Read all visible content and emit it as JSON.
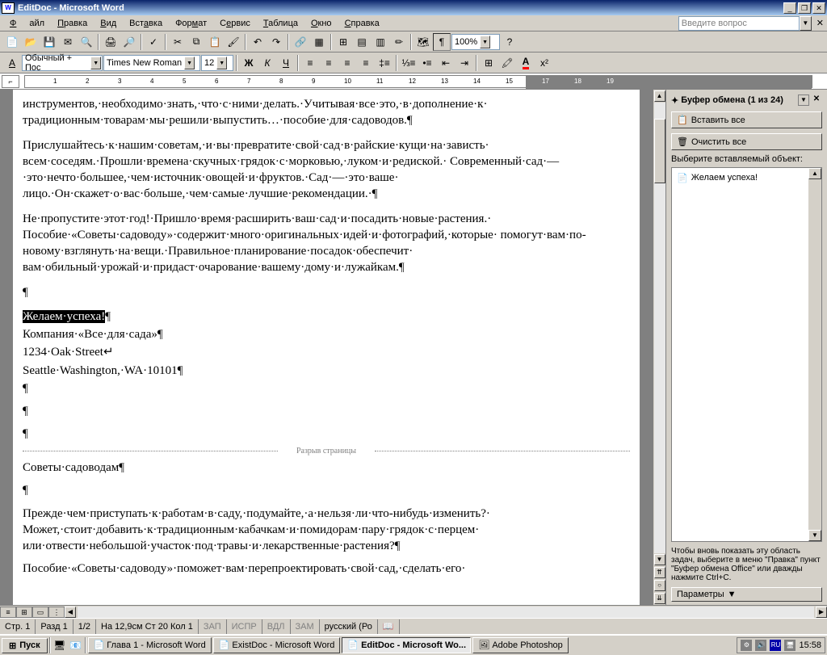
{
  "window": {
    "title": "EditDoc - Microsoft Word"
  },
  "menu": {
    "file": "Файл",
    "edit": "Правка",
    "view": "Вид",
    "insert": "Вставка",
    "format": "Формат",
    "tools": "Сервис",
    "table": "Таблица",
    "window": "Окно",
    "help": "Справка"
  },
  "askbox": {
    "placeholder": "Введите вопрос"
  },
  "toolbar2": {
    "style": "Обычный + Пос",
    "font": "Times New Roman",
    "size": "12"
  },
  "zoom": "100%",
  "document": {
    "para1": "инструментов,·необходимо·знать,·что·с·ними·делать.·Учитывая·все·это,·в·дополнение·к· традиционным·товарам·мы·решили·выпустить…·пособие·для·садоводов.¶",
    "para2": "Прислушайтесь·к·нашим·советам,·и·вы·превратите·свой·сад·в·райские·кущи·на·зависть· всем·соседям.·Прошли·времена·скучных·грядок·с·морковью,·луком·и·редиской.· Современный·сад·—·это·нечто·большее,·чем·источник·овощей·и·фруктов.·Сад·—·это·ваше· лицо.·Он·скажет·о·вас·больше,·чем·самые·лучшие·рекомендации.·¶",
    "para3": "Не·пропустите·этот·год!·Пришло·время·расширить·ваш·сад·и·посадить·новые·растения.· Пособие·«Советы·садоводу»·содержит·много·оригинальных·идей·и·фотографий,·которые· помогут·вам·по-новому·взглянуть·на·вещи.·Правильное·планирование·посадок·обеспечит· вам·обильный·урожай·и·придаст·очарование·вашему·дому·и·лужайкам.¶",
    "empty": "¶",
    "selected": "Желаем·успеха!",
    "company": "Компания·«Все·для·сада»¶",
    "addr1": "1234·Oak·Street↵",
    "addr2": "Seattle·Washington,·WA·10101¶",
    "pagebreak": "Разрыв страницы",
    "heading2": "Советы·садоводам¶",
    "para4": "Прежде·чем·приступать·к·работам·в·саду,·подумайте,·а·нельзя·ли·что-нибудь·изменить?· Может,·стоит·добавить·к·традиционным·кабачкам·и·помидорам·пару·грядок·с·перцем· или·отвести·небольшой·участок·под·травы·и·лекарственные·растения?¶",
    "para5": "Пособие·«Советы·садоводу»·поможет·вам·перепроектировать·свой·сад,·сделать·его·"
  },
  "clipboard": {
    "title": "Буфер обмена (1 из 24)",
    "paste_all": "Вставить все",
    "clear_all": "Очистить все",
    "choose_label": "Выберите вставляемый объект:",
    "item1": "Желаем успеха!",
    "help": "Чтобы вновь показать эту область задач, выберите в меню \"Правка\" пункт \"Буфер обмена Office\" или дважды нажмите Ctrl+C.",
    "params": "Параметры"
  },
  "status": {
    "page": "Стр. 1",
    "section": "Разд 1",
    "pages": "1/2",
    "position": "На 12,9см Ст 20    Кол 1",
    "rec": "ЗАП",
    "rev": "ИСПР",
    "ext": "ВДЛ",
    "ovr": "ЗАМ",
    "lang": "русский (Ро"
  },
  "taskbar": {
    "start": "Пуск",
    "item1": "Глава 1 - Microsoft Word",
    "item2": "ExistDoc - Microsoft Word",
    "item3": "EditDoc - Microsoft Wo...",
    "item4": "Adobe Photoshop",
    "lang_ind": "RU",
    "time": "15:58"
  }
}
